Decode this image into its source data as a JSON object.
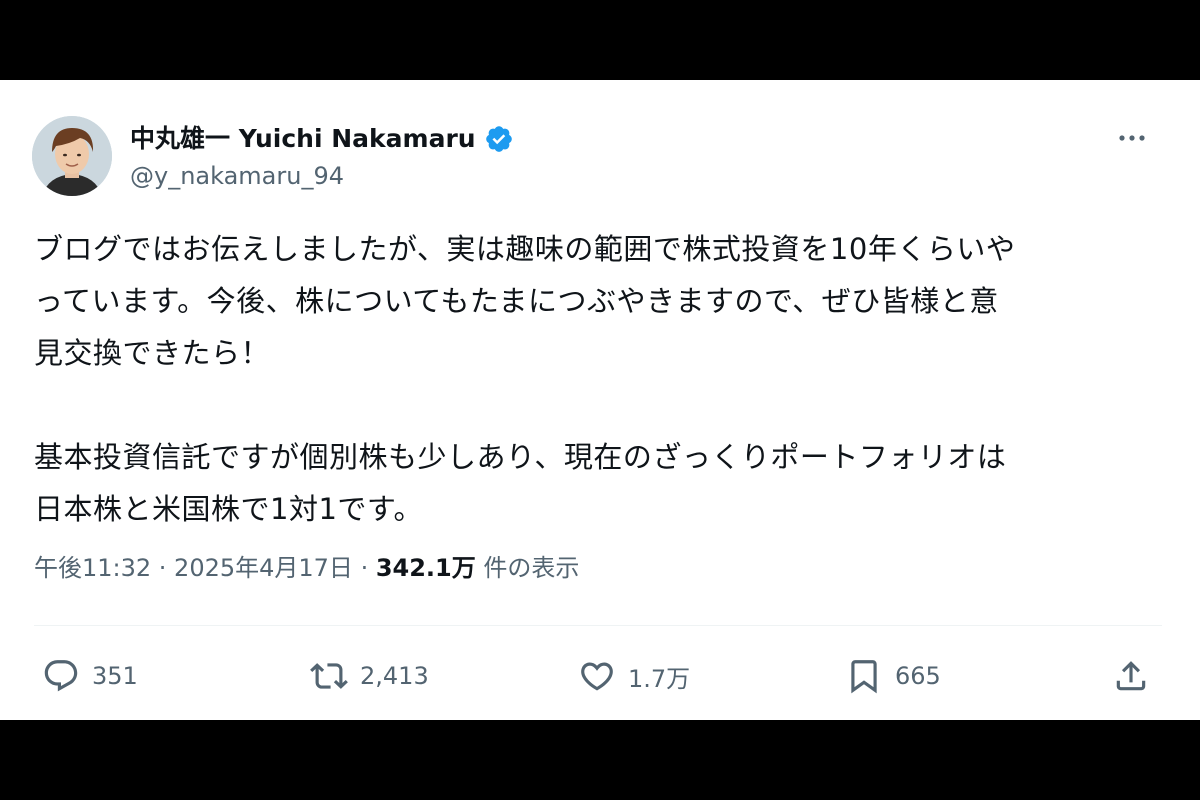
{
  "tweet": {
    "author": {
      "display_name": "中丸雄一 Yuichi Nakamaru",
      "handle": "@y_nakamaru_94",
      "verified": true,
      "verified_color": "#1d9bf0"
    },
    "text_lines": [
      "ブログではお伝えしましたが、実は趣味の範囲で株式投資を10年くらいや",
      "っています。今後、株についてもたまにつぶやきますので、ぜひ皆様と意",
      "見交換できたら！",
      "",
      "基本投資信託ですが個別株も少しあり、現在のざっくりポートフォリオは",
      "日本株と米国株で1対1です。"
    ],
    "timestamp": "午後11:32 · 2025年4月17日 · ",
    "views_count": "342.1万",
    "views_label": " 件の表示",
    "actions": {
      "reply_count": "351",
      "retweet_count": "2,413",
      "like_count": "1.7万",
      "bookmark_count": "665"
    }
  },
  "colors": {
    "text_primary": "#0f1419",
    "text_secondary": "#536471",
    "divider": "#eff3f4",
    "letterbox": "#000000"
  }
}
